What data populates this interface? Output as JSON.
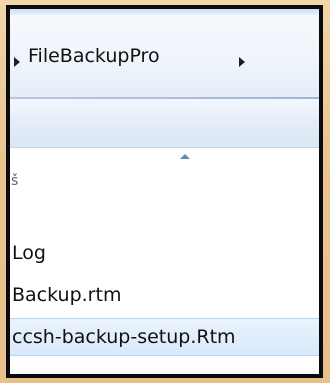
{
  "breadcrumb": {
    "folder": "FileBackupPro"
  },
  "column_fragment": "š",
  "files": [
    {
      "name": "Log"
    },
    {
      "name": "Backup.rtm"
    },
    {
      "name": "ccsh-backup-setup.Rtm"
    }
  ]
}
